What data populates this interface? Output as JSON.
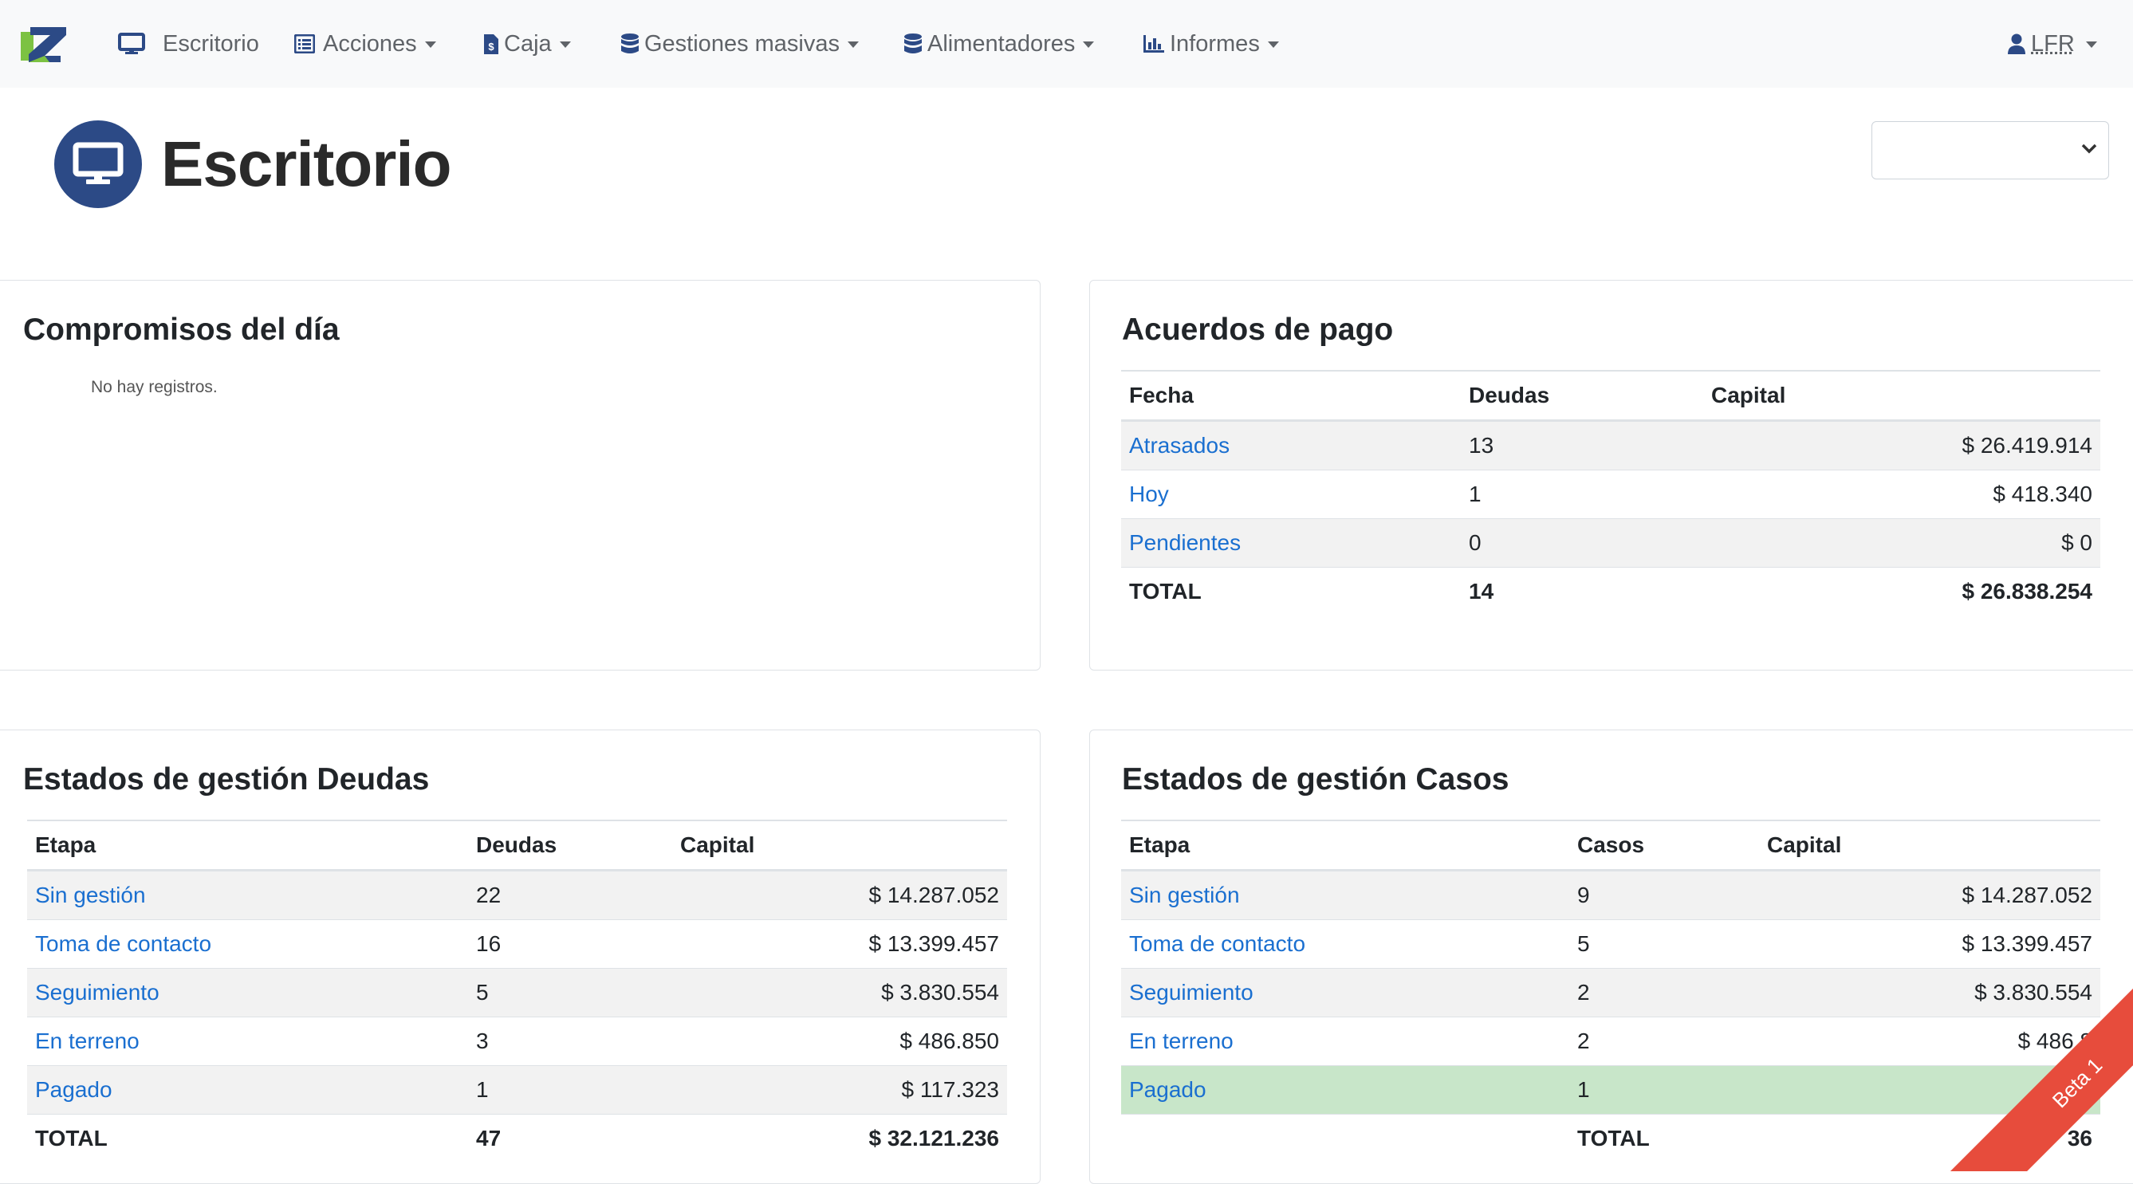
{
  "nav": {
    "items": [
      {
        "label": "Escritorio"
      },
      {
        "label": "Acciones"
      },
      {
        "label": "Caja"
      },
      {
        "label": "Gestiones masivas"
      },
      {
        "label": "Alimentadores"
      },
      {
        "label": "Informes"
      }
    ],
    "user": "LFR"
  },
  "page": {
    "title": "Escritorio",
    "select_value": ""
  },
  "compromisos": {
    "title": "Compromisos del día",
    "empty": "No hay registros."
  },
  "acuerdos": {
    "title": "Acuerdos de pago",
    "columns": [
      "Fecha",
      "Deudas",
      "Capital"
    ],
    "rows": [
      {
        "label": "Atrasados",
        "count": "13",
        "capital": "$ 26.419.914"
      },
      {
        "label": "Hoy",
        "count": "1",
        "capital": "$ 418.340"
      },
      {
        "label": "Pendientes",
        "count": "0",
        "capital": "$ 0"
      }
    ],
    "total": {
      "label": "TOTAL",
      "count": "14",
      "capital": "$ 26.838.254"
    }
  },
  "deudas": {
    "title": "Estados de gestión Deudas",
    "columns": [
      "Etapa",
      "Deudas",
      "Capital"
    ],
    "rows": [
      {
        "label": "Sin gestión",
        "count": "22",
        "capital": "$ 14.287.052"
      },
      {
        "label": "Toma de contacto",
        "count": "16",
        "capital": "$ 13.399.457"
      },
      {
        "label": "Seguimiento",
        "count": "5",
        "capital": "$ 3.830.554"
      },
      {
        "label": "En terreno",
        "count": "3",
        "capital": "$ 486.850"
      },
      {
        "label": "Pagado",
        "count": "1",
        "capital": "$ 117.323"
      }
    ],
    "total": {
      "label": "TOTAL",
      "count": "47",
      "capital": "$ 32.121.236"
    }
  },
  "casos": {
    "title": "Estados de gestión Casos",
    "columns": [
      "Etapa",
      "Casos",
      "Capital"
    ],
    "rows": [
      {
        "label": "Sin gestión",
        "count": "9",
        "capital": "$ 14.287.052"
      },
      {
        "label": "Toma de contacto",
        "count": "5",
        "capital": "$ 13.399.457"
      },
      {
        "label": "Seguimiento",
        "count": "2",
        "capital": "$ 3.830.554"
      },
      {
        "label": "En terreno",
        "count": "2",
        "capital": "$ 486.8"
      },
      {
        "label": "Pagado",
        "count": "1",
        "capital": "$"
      }
    ],
    "total": {
      "label": "TOTAL",
      "capital": "36"
    }
  },
  "ribbon": {
    "label": "Beta 1"
  },
  "colors": {
    "accent": "#2c4a86",
    "link": "#1a6fd0",
    "ribbon": "#e74c3c",
    "highlight": "#c8e6c9"
  }
}
